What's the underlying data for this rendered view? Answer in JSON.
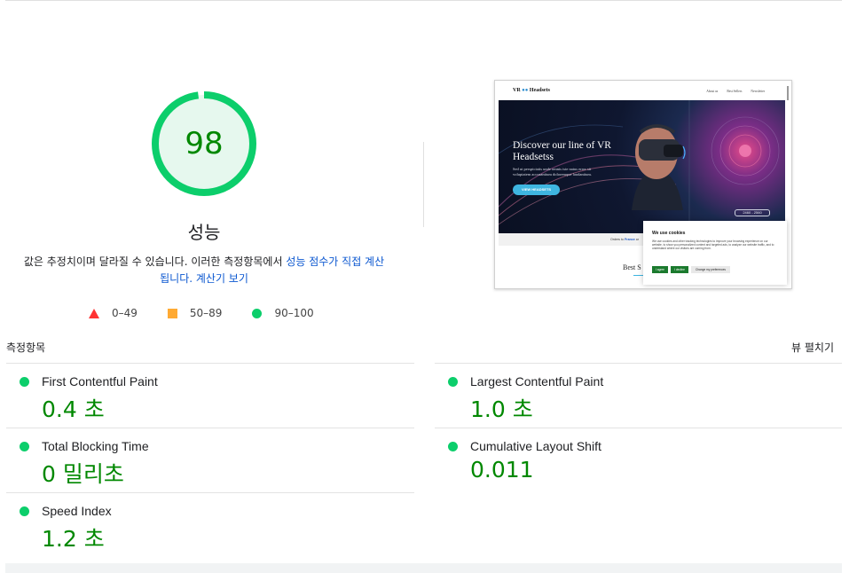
{
  "gauge": {
    "score": "98",
    "score_fraction": 0.98,
    "title": "성능",
    "color": "#0cce6b"
  },
  "description": {
    "prefix": "값은 추정치이며 달라질 수 있습니다. 이러한 측정항목에서 ",
    "link_score": "성능 점수가 직접 계산됩니다.",
    "link_calculator": "계산기 보기"
  },
  "legend": [
    {
      "icon": "triangle-icon",
      "range": "0–49",
      "color": "#ff3333"
    },
    {
      "icon": "square-icon",
      "range": "50–89",
      "color": "#ffaa33"
    },
    {
      "icon": "circle-icon",
      "range": "90–100",
      "color": "#0cce6b"
    }
  ],
  "screenshot": {
    "logo": "VR",
    "logo_suffix": "Headsets",
    "nav_links": [
      "About us",
      "Best Sellers",
      "Newsletter"
    ],
    "hero_heading": "Discover our line of VR Headsetss",
    "hero_body": "Sed ut perspiciatis unde omnis iste natus error sit voluptatem accusantium doloremque laudantium.",
    "hero_button": "VIEW HEADSETS",
    "hero_price": "2460 - 2560",
    "strip_prefix": "Orders to ",
    "strip_bold": "France",
    "strip_suffix": " ar",
    "best_sellers": "Best S",
    "cookie_title": "We use cookies",
    "cookie_text": "We use cookies and other tracking technologies to improve your browsing experience on our website, to show you personalized content and targeted ads, to analyze our website traffic, and to understand where our visitors are coming from.",
    "cookie_agree": "I agree",
    "cookie_decline": "I decline",
    "cookie_prefs": "Change my preferences"
  },
  "metrics": {
    "label": "측정항목",
    "expand": "뷰 펼치기",
    "items": [
      {
        "name": "First Contentful Paint",
        "value": "0.4 초",
        "status_color": "#0cce6b"
      },
      {
        "name": "Largest Contentful Paint",
        "value": "1.0 초",
        "status_color": "#0cce6b"
      },
      {
        "name": "Total Blocking Time",
        "value": "0 밀리초",
        "status_color": "#0cce6b"
      },
      {
        "name": "Cumulative Layout Shift",
        "value": "0.011",
        "status_color": "#0cce6b"
      },
      {
        "name": "Speed Index",
        "value": "1.2 초",
        "status_color": "#0cce6b"
      }
    ]
  }
}
